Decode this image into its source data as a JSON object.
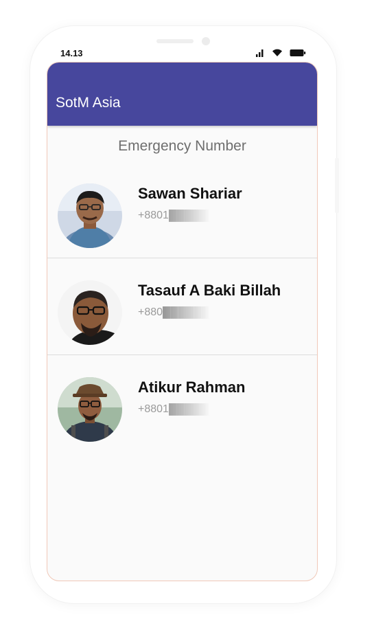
{
  "status_bar": {
    "time": "14.13",
    "icons": [
      "signal-icon",
      "wifi-icon",
      "battery-icon"
    ]
  },
  "app_bar": {
    "title": "SotM Asia",
    "color": "#47479d"
  },
  "section": {
    "title": "Emergency Number"
  },
  "contacts": [
    {
      "name": "Sawan Shariar",
      "phone": "+8801███████048"
    },
    {
      "name": "Tasauf A Baki Billah",
      "phone": "+880███████63"
    },
    {
      "name": "Atikur Rahman",
      "phone": "+8801██████"
    }
  ]
}
